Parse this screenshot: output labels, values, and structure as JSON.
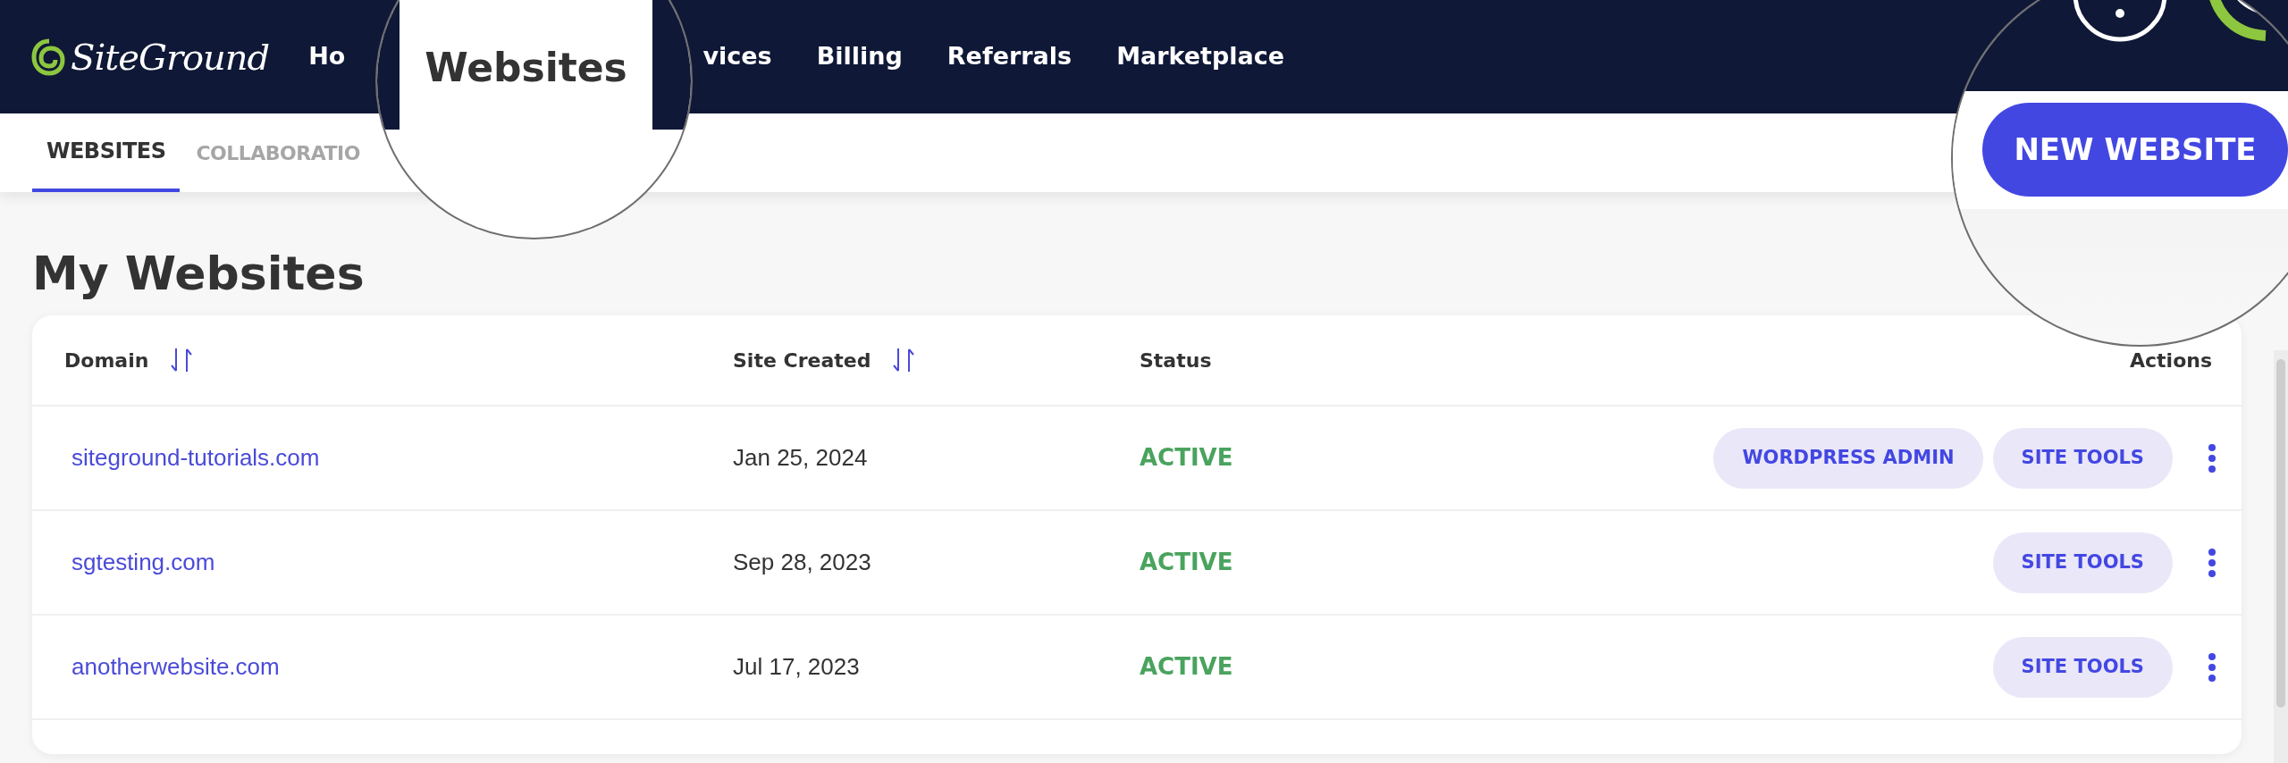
{
  "nav": {
    "logo": "SiteGround",
    "items_before_lens": [
      {
        "label": "Ho"
      }
    ],
    "items_after_lens": [
      {
        "label": "vices"
      },
      {
        "label": "Billing"
      },
      {
        "label": "Referrals"
      },
      {
        "label": "Marketplace"
      }
    ]
  },
  "nav_magnifier": {
    "tab": {
      "label": "Websites",
      "selected": true
    }
  },
  "subnav": {
    "tabs": [
      {
        "label": "WEBSITES",
        "selected": true
      },
      {
        "label": "COLLABORATIO",
        "selected": false
      }
    ]
  },
  "action_magnifier": {
    "button": "NEW WEBSITE"
  },
  "heading": "My Websites",
  "table": {
    "columns": [
      {
        "label": "Domain",
        "sortable": true
      },
      {
        "label": "Site Created",
        "sortable": true
      },
      {
        "label": "Status",
        "sortable": false
      },
      {
        "label": "Actions",
        "sortable": false
      }
    ],
    "rows": [
      {
        "domain": "siteground-tutorials.com",
        "created": "Jan 25, 2024",
        "status": "ACTIVE",
        "actions": [
          "WORDPRESS ADMIN",
          "SITE TOOLS"
        ]
      },
      {
        "domain": "sgtesting.com",
        "created": "Sep 28, 2023",
        "status": "ACTIVE",
        "actions": [
          "SITE TOOLS"
        ]
      },
      {
        "domain": "anotherwebsite.com",
        "created": "Jul 17, 2023",
        "status": "ACTIVE",
        "actions": [
          "SITE TOOLS"
        ]
      }
    ]
  }
}
